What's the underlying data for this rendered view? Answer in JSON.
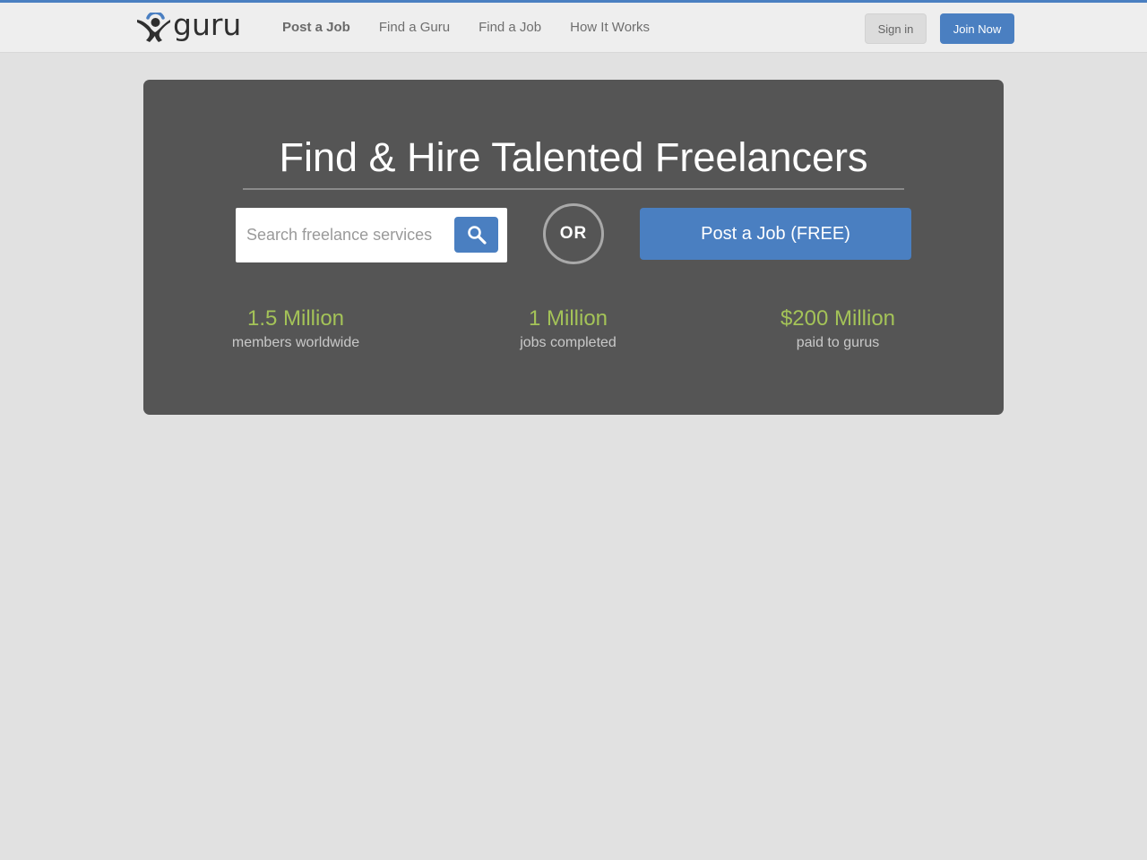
{
  "header": {
    "logo_text": "guru",
    "nav": [
      "Post a Job",
      "Find a Guru",
      "Find a Job",
      "How It Works"
    ],
    "sign_in": "Sign in",
    "join_now": "Join Now"
  },
  "hero": {
    "title": "Find & Hire Talented Freelancers",
    "search_placeholder": "Search freelance services",
    "or": "OR",
    "post_job": "Post a Job (FREE)"
  },
  "stats": [
    {
      "value": "1.5 Million",
      "label": "members worldwide"
    },
    {
      "value": "1 Million",
      "label": "jobs completed"
    },
    {
      "value": "$200 Million",
      "label": "paid to gurus"
    }
  ],
  "colors": {
    "accent": "#4a7fc1",
    "stat_green": "#a4c358",
    "hero_bg": "#555555",
    "page_bg": "#e1e1e1"
  }
}
